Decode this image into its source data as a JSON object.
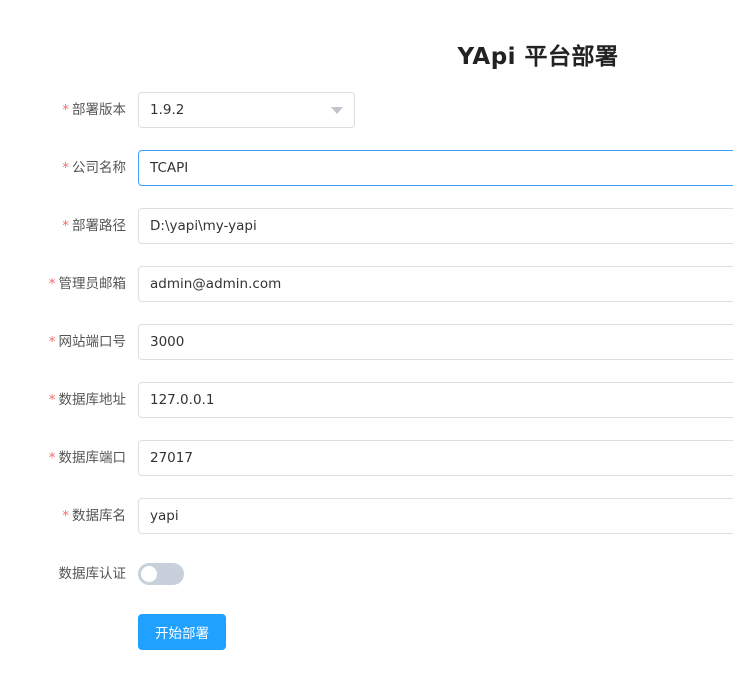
{
  "page": {
    "title": "YApi 平台部署"
  },
  "form": {
    "version": {
      "label": "部署版本",
      "value": "1.9.2",
      "required": true
    },
    "company": {
      "label": "公司名称",
      "value": "TCAPI",
      "required": true
    },
    "deploy_path": {
      "label": "部署路径",
      "value": "D:\\yapi\\my-yapi",
      "required": true
    },
    "admin_email": {
      "label": "管理员邮箱",
      "value": "admin@admin.com",
      "required": true
    },
    "site_port": {
      "label": "网站端口号",
      "value": "3000",
      "required": true
    },
    "db_host": {
      "label": "数据库地址",
      "value": "127.0.0.1",
      "required": true
    },
    "db_port": {
      "label": "数据库端口",
      "value": "27017",
      "required": true
    },
    "db_name": {
      "label": "数据库名",
      "value": "yapi",
      "required": true
    },
    "db_auth": {
      "label": "数据库认证",
      "enabled": false
    },
    "required_mark": "*",
    "submit_label": "开始部署"
  },
  "colors": {
    "primary": "#20a0ff",
    "required": "#f56c6c",
    "focus_border": "#409eff",
    "switch_off": "#c7d0db"
  }
}
